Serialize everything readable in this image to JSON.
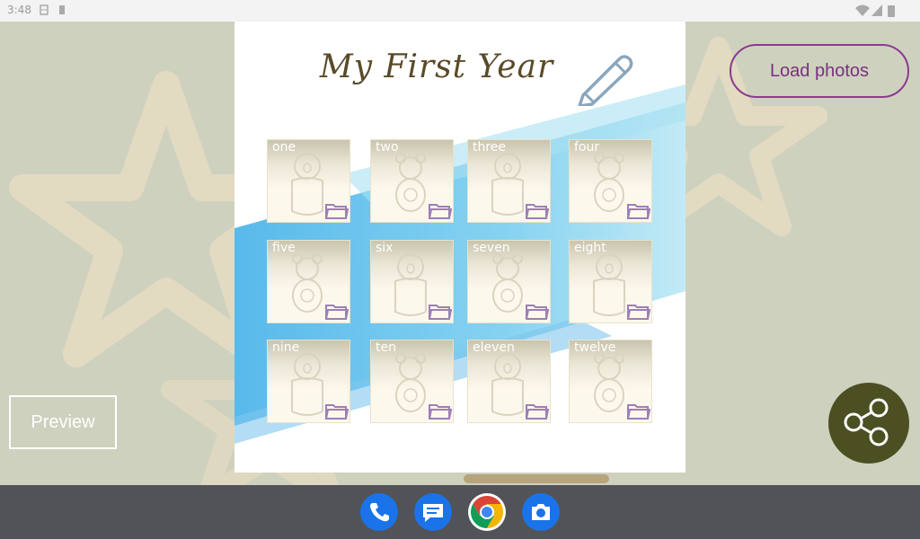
{
  "status_bar": {
    "time": "3:48"
  },
  "card": {
    "title": "My First Year",
    "tiles": [
      {
        "label": "one",
        "art": "baby"
      },
      {
        "label": "two",
        "art": "teddy"
      },
      {
        "label": "three",
        "art": "baby"
      },
      {
        "label": "four",
        "art": "teddy"
      },
      {
        "label": "five",
        "art": "teddy"
      },
      {
        "label": "six",
        "art": "baby"
      },
      {
        "label": "seven",
        "art": "teddy"
      },
      {
        "label": "eight",
        "art": "baby"
      },
      {
        "label": "nine",
        "art": "baby"
      },
      {
        "label": "ten",
        "art": "teddy"
      },
      {
        "label": "eleven",
        "art": "baby"
      },
      {
        "label": "twelve",
        "art": "teddy"
      }
    ]
  },
  "buttons": {
    "load_photos": "Load photos",
    "preview": "Preview"
  },
  "icons": {
    "edit": "pencil-icon",
    "share": "share-icon",
    "folder": "folder-icon"
  },
  "dock": {
    "apps": [
      "phone-app",
      "messages-app",
      "chrome-app",
      "camera-app"
    ]
  },
  "colors": {
    "accent_purple": "#7a2f82",
    "fab_olive": "#4b4f22",
    "background": "#cfd1bf",
    "brush_blue": "#5bc3ec"
  }
}
